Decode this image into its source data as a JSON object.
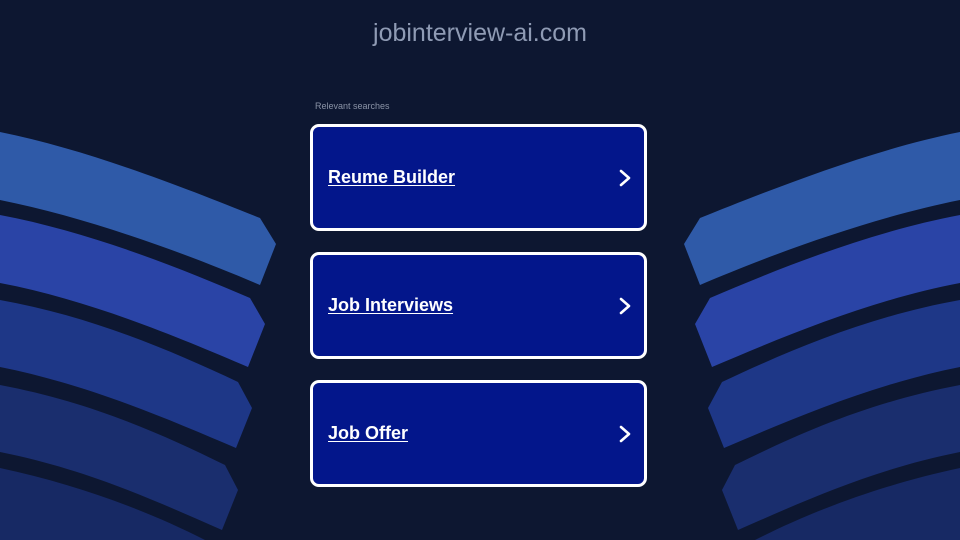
{
  "header": {
    "domain": "jobinterview-ai.com"
  },
  "relevant_searches": {
    "label": "Relevant searches",
    "links": [
      {
        "label": "Reume Builder",
        "icon": "chevron-right-icon"
      },
      {
        "label": "Job Interviews",
        "icon": "chevron-right-icon"
      },
      {
        "label": "Job Offer",
        "icon": "chevron-right-icon"
      }
    ]
  },
  "colors": {
    "background": "#0d1731",
    "card_background": "#03168b",
    "card_border": "#ffffff",
    "wave_light": "#2f5aa8",
    "wave_mid": "#2a44a6",
    "wave_dark": "#1a2e6e",
    "title_text": "#8f9bb4"
  }
}
